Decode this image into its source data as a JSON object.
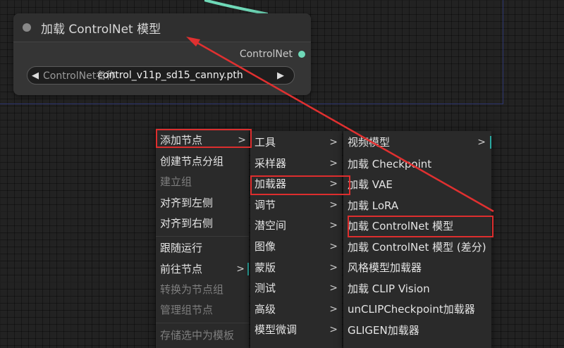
{
  "node": {
    "title": "加载 ControlNet 模型",
    "output_label": "ControlNet",
    "widget": {
      "label": "ControlNet名称",
      "value": "control_v11p_sd15_canny.pth",
      "left_arrow": "◀",
      "right_arrow": "▶"
    }
  },
  "context_menu": {
    "items": [
      {
        "label": "添加节点",
        "submenu": ">",
        "disabled": false
      },
      {
        "label": "创建节点分组",
        "disabled": false
      },
      {
        "label": "建立组",
        "disabled": true
      },
      {
        "label": "对齐到左侧",
        "disabled": false
      },
      {
        "label": "对齐到右侧",
        "disabled": false
      },
      {
        "label": "跟随运行",
        "disabled": false
      },
      {
        "label": "前往节点",
        "submenu": ">",
        "disabled": false
      },
      {
        "label": "转换为节点组",
        "disabled": true
      },
      {
        "label": "管理组节点",
        "disabled": true
      },
      {
        "label": "存储选中为模板",
        "disabled": true
      }
    ]
  },
  "category_menu": {
    "items": [
      {
        "label": "工具",
        "submenu": ">"
      },
      {
        "label": "采样器",
        "submenu": ">"
      },
      {
        "label": "加载器",
        "submenu": ">"
      },
      {
        "label": "调节",
        "submenu": ">"
      },
      {
        "label": "潜空间",
        "submenu": ">"
      },
      {
        "label": "图像",
        "submenu": ">"
      },
      {
        "label": "蒙版",
        "submenu": ">"
      },
      {
        "label": "测试",
        "submenu": ">"
      },
      {
        "label": "高级",
        "submenu": ">"
      },
      {
        "label": "模型微调",
        "submenu": ">"
      }
    ]
  },
  "loader_menu": {
    "items": [
      {
        "label": "视频模型",
        "submenu": ">"
      },
      {
        "label": "加载 Checkpoint"
      },
      {
        "label": "加载 VAE"
      },
      {
        "label": "加载 LoRA"
      },
      {
        "label": "加载 ControlNet 模型"
      },
      {
        "label": "加载 ControlNet 模型 (差分)"
      },
      {
        "label": "风格模型加载器"
      },
      {
        "label": "加载 CLIP Vision"
      },
      {
        "label": "unCLIPCheckpoint加载器"
      },
      {
        "label": "GLIGEN加载器"
      }
    ]
  },
  "colors": {
    "highlight": "#dd2e2e",
    "annotation_arrow": "#e03030",
    "link": "#6fd9b8",
    "accent_bar": "#2aa8a0"
  }
}
